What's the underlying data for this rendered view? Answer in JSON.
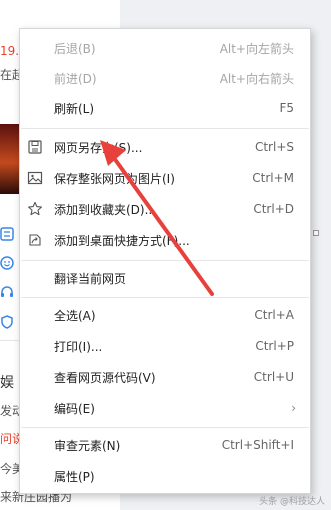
{
  "background": {
    "price_fragment": "19.9",
    "line2_fragment": "在起",
    "mid_text1": "娱",
    "mid_text2": "发动",
    "mid_text3": "问说",
    "mid_text4": "今美",
    "mid_text5": "来新庄园播为"
  },
  "context_menu": {
    "items": [
      {
        "label": "后退(B)",
        "shortcut": "Alt+向左箭头",
        "disabled": true,
        "icon": ""
      },
      {
        "label": "前进(D)",
        "shortcut": "Alt+向右箭头",
        "disabled": true,
        "icon": ""
      },
      {
        "label": "刷新(L)",
        "shortcut": "F5",
        "disabled": false,
        "icon": ""
      },
      {
        "label": "网页另存为(S)...",
        "shortcut": "Ctrl+S",
        "disabled": false,
        "icon": "save-icon"
      },
      {
        "label": "保存整张网页为图片(I)",
        "shortcut": "Ctrl+M",
        "disabled": false,
        "icon": "image-icon"
      },
      {
        "label": "添加到收藏夹(D)...",
        "shortcut": "Ctrl+D",
        "disabled": false,
        "icon": "star-icon"
      },
      {
        "label": "添加到桌面快捷方式(F)...",
        "shortcut": "",
        "disabled": false,
        "icon": "shortcut-icon"
      },
      {
        "label": "翻译当前网页",
        "shortcut": "",
        "disabled": false,
        "icon": ""
      },
      {
        "label": "全选(A)",
        "shortcut": "Ctrl+A",
        "disabled": false,
        "icon": ""
      },
      {
        "label": "打印(I)...",
        "shortcut": "Ctrl+P",
        "disabled": false,
        "icon": ""
      },
      {
        "label": "查看网页源代码(V)",
        "shortcut": "Ctrl+U",
        "disabled": false,
        "icon": ""
      },
      {
        "label": "编码(E)",
        "shortcut": "",
        "disabled": false,
        "icon": "",
        "submenu_glyph": "›"
      },
      {
        "label": "审查元素(N)",
        "shortcut": "Ctrl+Shift+I",
        "disabled": false,
        "icon": ""
      },
      {
        "label": "属性(P)",
        "shortcut": "",
        "disabled": false,
        "icon": ""
      }
    ]
  },
  "annotation": {
    "arrow_color": "#e8413b"
  },
  "watermark": "头条 @科技达人"
}
